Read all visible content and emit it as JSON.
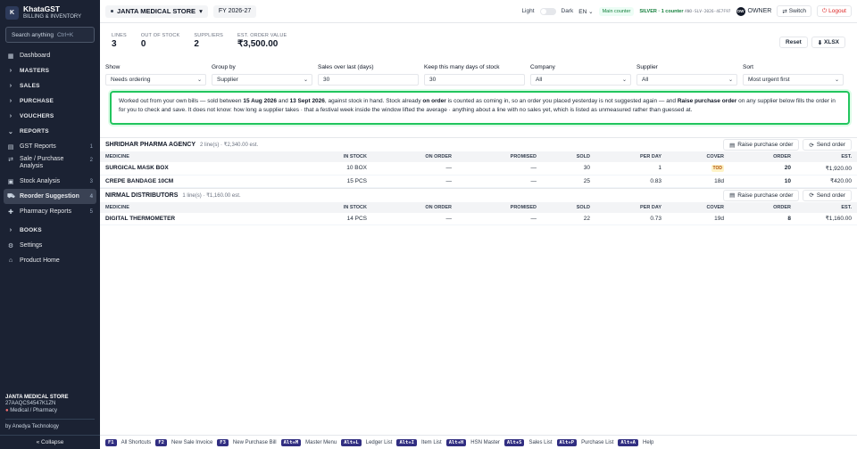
{
  "app": {
    "name": "KhataGST",
    "subtitle": "BILLING & INVENTORY",
    "logo": "K"
  },
  "sidebar": {
    "search_placeholder": "Search anything",
    "search_shortcut": "Ctrl+K",
    "items": [
      {
        "label": "Dashboard",
        "icon": "dashboard-icon"
      },
      {
        "label": "MASTERS",
        "icon": "chevron-right-icon"
      },
      {
        "label": "SALES",
        "icon": "chevron-right-icon"
      },
      {
        "label": "PURCHASE",
        "icon": "chevron-right-icon"
      },
      {
        "label": "VOUCHERS",
        "icon": "chevron-right-icon"
      },
      {
        "label": "REPORTS",
        "icon": "chevron-down-icon"
      },
      {
        "label": "GST Reports",
        "count": "1"
      },
      {
        "label": "Sale / Purchase Analysis",
        "count": "2"
      },
      {
        "label": "Stock Analysis",
        "count": "3"
      },
      {
        "label": "Reorder Suggestion",
        "count": "4"
      },
      {
        "label": "Pharmacy Reports",
        "count": "5"
      },
      {
        "label": "BOOKS",
        "icon": "chevron-right-icon"
      },
      {
        "label": "Settings",
        "icon": "gear-icon"
      },
      {
        "label": "Product Home",
        "icon": "home-icon"
      }
    ],
    "footer": {
      "store_name": "JANTA MEDICAL STORE",
      "gstin": "27AAQCS4547K1ZN",
      "store_type": "Medical / Pharmacy",
      "byline": "by Anedya Technology",
      "collapse": "« Collapse"
    }
  },
  "topbar": {
    "store": "JANTA MEDICAL STORE",
    "fy": "FY 2026-27",
    "light": "Light",
    "dark": "Dark",
    "lang": "EN",
    "main_counter": "Main counter",
    "silver": "SILVER · 1 counter",
    "license_code": "ANO-SLV-2026-4E7F97",
    "owner_initials": "OW",
    "owner": "OWNER",
    "switch": "Switch",
    "logout": "Logout"
  },
  "stats": [
    {
      "label": "LINES",
      "value": "3"
    },
    {
      "label": "OUT OF STOCK",
      "value": "0"
    },
    {
      "label": "SUPPLIERS",
      "value": "2"
    },
    {
      "label": "EST. ORDER VALUE",
      "value": "₹3,500.00"
    }
  ],
  "actions": {
    "reset": "Reset",
    "xlsx": "XLSX"
  },
  "filters": [
    {
      "label": "Show",
      "value": "Needs ordering",
      "select": true
    },
    {
      "label": "Group by",
      "value": "Supplier",
      "select": true
    },
    {
      "label": "Sales over last (days)",
      "value": "30",
      "select": false
    },
    {
      "label": "Keep this many days of stock",
      "value": "30",
      "select": false
    },
    {
      "label": "Company",
      "value": "All",
      "select": true
    },
    {
      "label": "Supplier",
      "value": "All",
      "select": true
    },
    {
      "label": "Sort",
      "value": "Most urgent first",
      "select": true
    }
  ],
  "info": {
    "t1": "Worked out from your own bills — sold between ",
    "d1": "15 Aug 2026",
    "t2": " and ",
    "d2": "13 Sept 2026",
    "t3": ", against stock in hand. Stock already ",
    "b1": "on order",
    "t4": " is counted as coming in, so an order you placed yesterday is not suggested again — and ",
    "b2": "Raise purchase order",
    "t5": " on any supplier below fills the order in for you to check and save. It does not know: how long a supplier takes · that a festival week inside the window lifted the average · anything about a line with no sales yet, which is listed as unmeasured rather than guessed at."
  },
  "table_headers": [
    "MEDICINE",
    "IN STOCK",
    "ON ORDER",
    "PROMISED",
    "SOLD",
    "PER DAY",
    "COVER",
    "ORDER",
    "EST."
  ],
  "raise_po": "Raise purchase order",
  "send_order": "Send order",
  "suppliers": [
    {
      "name": "SHRIDHAR PHARMA AGENCY",
      "meta": "2 line(s) · ₹2,340.00 est.",
      "rows": [
        {
          "medicine": "SURGICAL MASK BOX",
          "in_stock": "10 BOX",
          "on_order": "—",
          "promised": "—",
          "sold": "30",
          "per_day": "1",
          "cover": "TOD",
          "order": "20",
          "est": "₹1,920.00"
        },
        {
          "medicine": "CREPE BANDAGE 10CM",
          "in_stock": "15 PCS",
          "on_order": "—",
          "promised": "—",
          "sold": "25",
          "per_day": "0.83",
          "cover": "18d",
          "order": "10",
          "est": "₹420.00"
        }
      ]
    },
    {
      "name": "NIRMAL DISTRIBUTORS",
      "meta": "1 line(s) · ₹1,160.00 est.",
      "rows": [
        {
          "medicine": "DIGITAL THERMOMETER",
          "in_stock": "14 PCS",
          "on_order": "—",
          "promised": "—",
          "sold": "22",
          "per_day": "0.73",
          "cover": "19d",
          "order": "8",
          "est": "₹1,160.00"
        }
      ]
    }
  ],
  "shortcuts": [
    {
      "key": "F1",
      "label": "All Shortcuts"
    },
    {
      "key": "F2",
      "label": "New Sale Invoice"
    },
    {
      "key": "F3",
      "label": "New Purchase Bill"
    },
    {
      "key": "Alt+M",
      "label": "Master Menu"
    },
    {
      "key": "Alt+L",
      "label": "Ledger List"
    },
    {
      "key": "Alt+I",
      "label": "Item List"
    },
    {
      "key": "Alt+H",
      "label": "HSN Master"
    },
    {
      "key": "Alt+S",
      "label": "Sales List"
    },
    {
      "key": "Alt+P",
      "label": "Purchase List"
    },
    {
      "key": "Alt+A",
      "label": "Help"
    }
  ],
  "colors": {
    "sidebar_bg": "#1b2233",
    "accent_green": "#22c55e",
    "logout_red": "#dc2626",
    "key_bg": "#312e81"
  }
}
